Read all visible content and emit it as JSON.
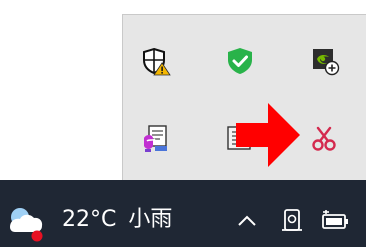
{
  "tray_flyout": {
    "icons": [
      {
        "name": "windows-security-warning-icon"
      },
      {
        "name": "shield-check-icon"
      },
      {
        "name": "nvidia-icon"
      },
      {
        "name": "installer-app-icon"
      },
      {
        "name": "printer-document-icon"
      },
      {
        "name": "scissors-icon"
      }
    ]
  },
  "annotation": {
    "arrow_color": "#ff0000"
  },
  "taskbar": {
    "background": "#1f2734",
    "weather": {
      "temperature": "22°C",
      "condition": "小雨",
      "icon": "rain-cloud-icon"
    },
    "system_icons": [
      {
        "name": "show-hidden-icons-chevron-icon"
      },
      {
        "name": "camera-status-icon"
      },
      {
        "name": "battery-icon"
      }
    ]
  }
}
